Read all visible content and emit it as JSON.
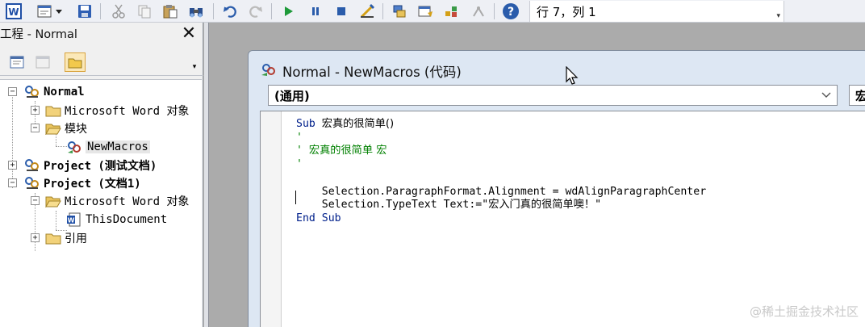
{
  "toolbar": {
    "buttons": [
      {
        "name": "view-word-icon"
      },
      {
        "name": "insert-userform-icon"
      },
      {
        "name": "save-icon"
      },
      {
        "name": "cut-icon"
      },
      {
        "name": "copy-icon"
      },
      {
        "name": "paste-icon"
      },
      {
        "name": "find-icon"
      },
      {
        "name": "undo-icon"
      },
      {
        "name": "redo-icon"
      },
      {
        "name": "run-icon"
      },
      {
        "name": "break-icon"
      },
      {
        "name": "reset-icon"
      },
      {
        "name": "design-mode-icon"
      },
      {
        "name": "project-explorer-icon"
      },
      {
        "name": "properties-window-icon"
      },
      {
        "name": "object-browser-icon"
      },
      {
        "name": "toolbox-icon"
      },
      {
        "name": "help-icon"
      }
    ],
    "position": "行 7，列 1"
  },
  "project_explorer": {
    "title": "工程 - Normal",
    "close": "✕",
    "tree": {
      "normal_label": "Normal",
      "ms_word_objects_1": "Microsoft Word 对象",
      "modules": "模块",
      "newmacros": "NewMacros",
      "project_test": "Project (测试文档)",
      "project_doc1": "Project (文档1)",
      "ms_word_objects_2": "Microsoft Word 对象",
      "thisdocument": "ThisDocument",
      "references": "引用"
    }
  },
  "code_window": {
    "title": "Normal - NewMacros (代码)",
    "object_combo": "(通用)",
    "proc_combo": "宏",
    "code_lines": [
      {
        "parts": [
          {
            "t": "Sub ",
            "c": "kw"
          },
          {
            "t": "宏真的很简单()",
            "c": "cjk"
          }
        ]
      },
      {
        "parts": [
          {
            "t": "'",
            "c": "cm"
          }
        ]
      },
      {
        "parts": [
          {
            "t": "' ",
            "c": "cm"
          },
          {
            "t": "宏真的很简单 宏",
            "c": "cm cjk"
          }
        ]
      },
      {
        "parts": [
          {
            "t": "'",
            "c": "cm"
          }
        ]
      },
      {
        "parts": [
          {
            "t": "",
            "c": ""
          }
        ]
      },
      {
        "parts": [
          {
            "t": "    Selection.ParagraphFormat.Alignment = wdAlignParagraphCenter",
            "c": ""
          }
        ]
      },
      {
        "parts": [
          {
            "t": "    Selection.TypeText Text:=\"",
            "c": ""
          },
          {
            "t": "宏入门真的很简单噢！",
            "c": "cjk"
          },
          {
            "t": "\"",
            "c": ""
          }
        ]
      },
      {
        "parts": [
          {
            "t": "End Sub",
            "c": "kw"
          }
        ]
      }
    ]
  },
  "watermark": "@稀土掘金技术社区",
  "colors": {
    "keyword": "#00208b",
    "comment": "#008000",
    "mdi_background": "#ababab",
    "selection_highlight": "#fbe8b8"
  }
}
